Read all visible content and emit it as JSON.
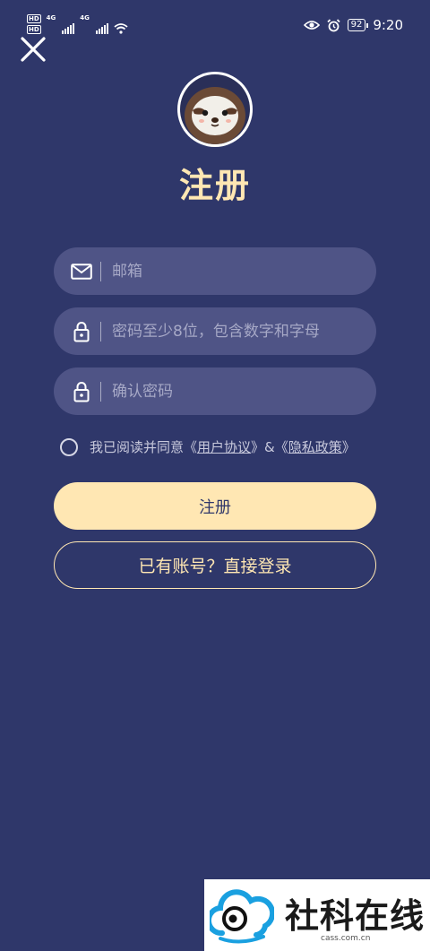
{
  "status_bar": {
    "hd1": "HD",
    "hd2": "HD",
    "net1": "4G",
    "net2": "4G",
    "battery": "92",
    "time": "9:20"
  },
  "header": {
    "title": "注册"
  },
  "form": {
    "email_placeholder": "邮箱",
    "password_placeholder": "密码至少8位，包含数字和字母",
    "confirm_placeholder": "确认密码"
  },
  "agreement": {
    "prefix": "我已阅读并同意《",
    "user_agreement": "用户协议",
    "middle": "》&《",
    "privacy_policy": "隐私政策",
    "suffix": "》"
  },
  "actions": {
    "register_label": "注册",
    "login_label": "已有账号？直接登录"
  },
  "watermark": {
    "name": "社科在线",
    "url": "cass.com.cn"
  },
  "colors": {
    "background": "#2f376a",
    "accent": "#ffe7b3",
    "field": "#4f5486"
  }
}
